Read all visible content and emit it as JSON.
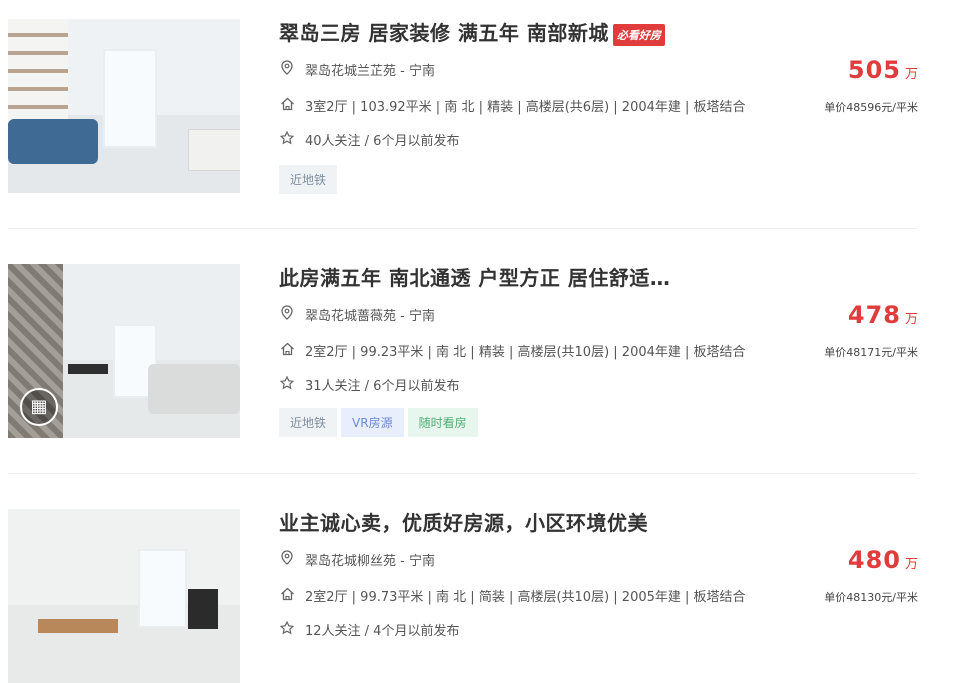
{
  "listings": [
    {
      "title": "翠岛三房 居家装修 满五年 南部新城",
      "badge": "必看好房",
      "community": "翠岛花城兰芷苑 - 宁南",
      "info": "3室2厅 | 103.92平米 | 南 北 | 精装 | 高楼层(共6层) | 2004年建 | 板塔结合",
      "follow": "40人关注 / 6个月以前发布",
      "price": "505",
      "price_unit": "万",
      "unit_price": "单价48596元/平米",
      "tags": [
        "近地铁"
      ]
    },
    {
      "title": "此房满五年 南北通透 户型方正 居住舒适…",
      "community": "翠岛花城蔷薇苑 - 宁南",
      "info": "2室2厅 | 99.23平米 | 南 北 | 精装 | 高楼层(共10层) | 2004年建 | 板塔结合",
      "follow": "31人关注 / 6个月以前发布",
      "price": "478",
      "price_unit": "万",
      "unit_price": "单价48171元/平米",
      "tags": [
        "近地铁",
        "VR房源",
        "随时看房"
      ]
    },
    {
      "title": "业主诚心卖，优质好房源，小区环境优美",
      "community": "翠岛花城柳丝苑 - 宁南",
      "info": "2室2厅 | 99.73平米 | 南 北 | 简装 | 高楼层(共10层) | 2005年建 | 板塔结合",
      "follow": "12人关注 / 4个月以前发布",
      "price": "480",
      "price_unit": "万",
      "unit_price": "单价48130元/平米"
    }
  ],
  "icons": {
    "location": "location-pin-icon",
    "house": "house-icon",
    "star": "star-icon",
    "vr": "vr-icon"
  },
  "colors": {
    "price": "#e03c3c",
    "badge": "#e03c3c",
    "tag_subway": "#7f8fa0",
    "tag_vr": "#6d8ad8",
    "tag_anytime": "#4fae74"
  }
}
